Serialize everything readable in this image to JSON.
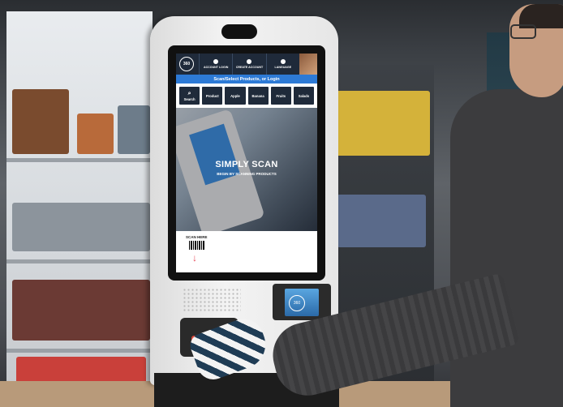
{
  "kiosk_screen": {
    "logo_text": "360",
    "top_buttons": [
      "ACCOUNT LOGIN",
      "CREATE ACCOUNT",
      "LANGUAGE"
    ],
    "subtitle": "Scan/Select Products, or Login",
    "categories": [
      {
        "label": "Search",
        "icon": "search-icon"
      },
      {
        "label": "Product",
        "icon": "product-icon"
      },
      {
        "label": "Apple",
        "icon": "apple-icon"
      },
      {
        "label": "Banana",
        "icon": "banana-icon"
      },
      {
        "label": "Fruits",
        "icon": "fruits-icon"
      },
      {
        "label": "Salads",
        "icon": "salads-icon"
      }
    ],
    "hero_title": "SIMPLY SCAN",
    "hero_subtitle": "BEGIN BY SCANNING PRODUCTS",
    "scan_label": "SCAN HERE"
  },
  "payment_terminal": {
    "logo_text": "360"
  },
  "colors": {
    "top_bar": "#1f2a3a",
    "accent_blue": "#2d7ad6",
    "scan_arrow": "#e74a5a"
  }
}
